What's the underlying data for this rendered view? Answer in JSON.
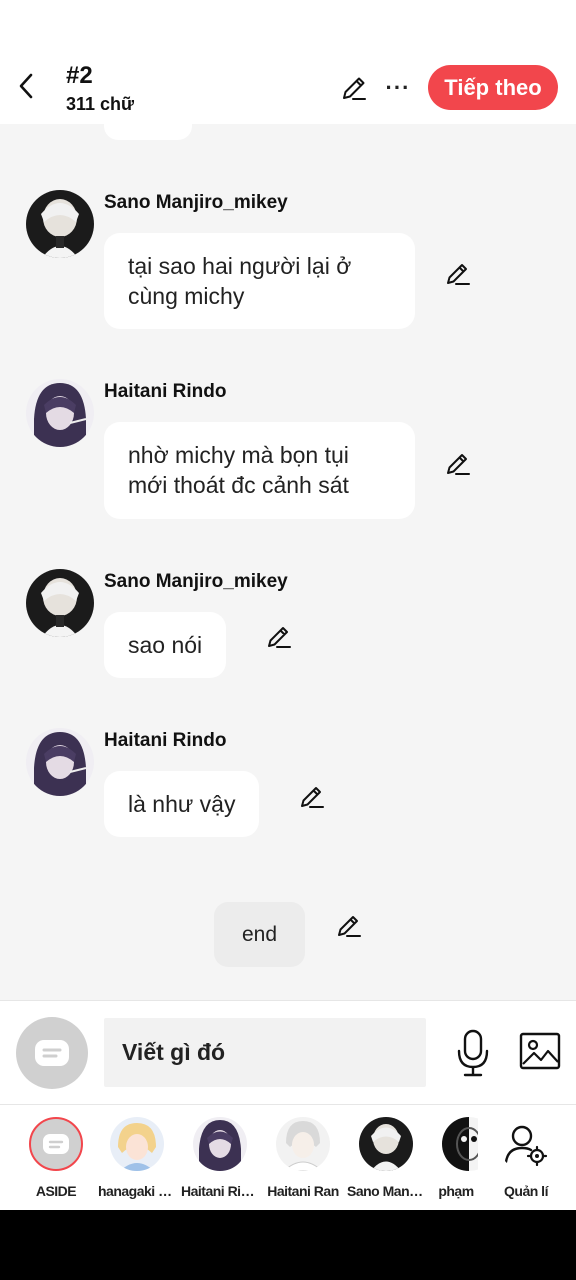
{
  "header": {
    "chapter_title": "#2",
    "word_count": "311 chữ",
    "next_label": "Tiếp theo"
  },
  "messages": [
    {
      "sender": "Sano Manjiro_mikey",
      "text": "tại sao hai người lại ở cùng michy",
      "avatar_tone": "light-hair"
    },
    {
      "sender": "Haitani Rindo",
      "text": "nhờ michy mà bọn tụi mới thoát đc cảnh sát",
      "avatar_tone": "purple-hair"
    },
    {
      "sender": "Sano Manjiro_mikey",
      "text": "sao nói",
      "avatar_tone": "light-hair"
    },
    {
      "sender": "Haitani Rindo",
      "text": "là như vậy",
      "avatar_tone": "purple-hair"
    }
  ],
  "end_label": "end",
  "composer": {
    "placeholder": "Viết gì đó"
  },
  "characters": [
    {
      "label": "ASIDE",
      "icon": "aside-icon"
    },
    {
      "label": "hanagaki takemichi",
      "icon": "avatar"
    },
    {
      "label": "Haitani Rindo",
      "icon": "avatar"
    },
    {
      "label": "Haitani Ran",
      "icon": "avatar"
    },
    {
      "label": "Sano Manjiro_mikey",
      "icon": "avatar"
    },
    {
      "label": "phạm",
      "icon": "avatar"
    },
    {
      "label": "Quản lí",
      "icon": "manage-icon"
    }
  ],
  "colors": {
    "accent": "#f2464c",
    "chat_bg": "#f5f5f5",
    "bubble": "#ffffff",
    "end_bubble": "#ececec"
  }
}
